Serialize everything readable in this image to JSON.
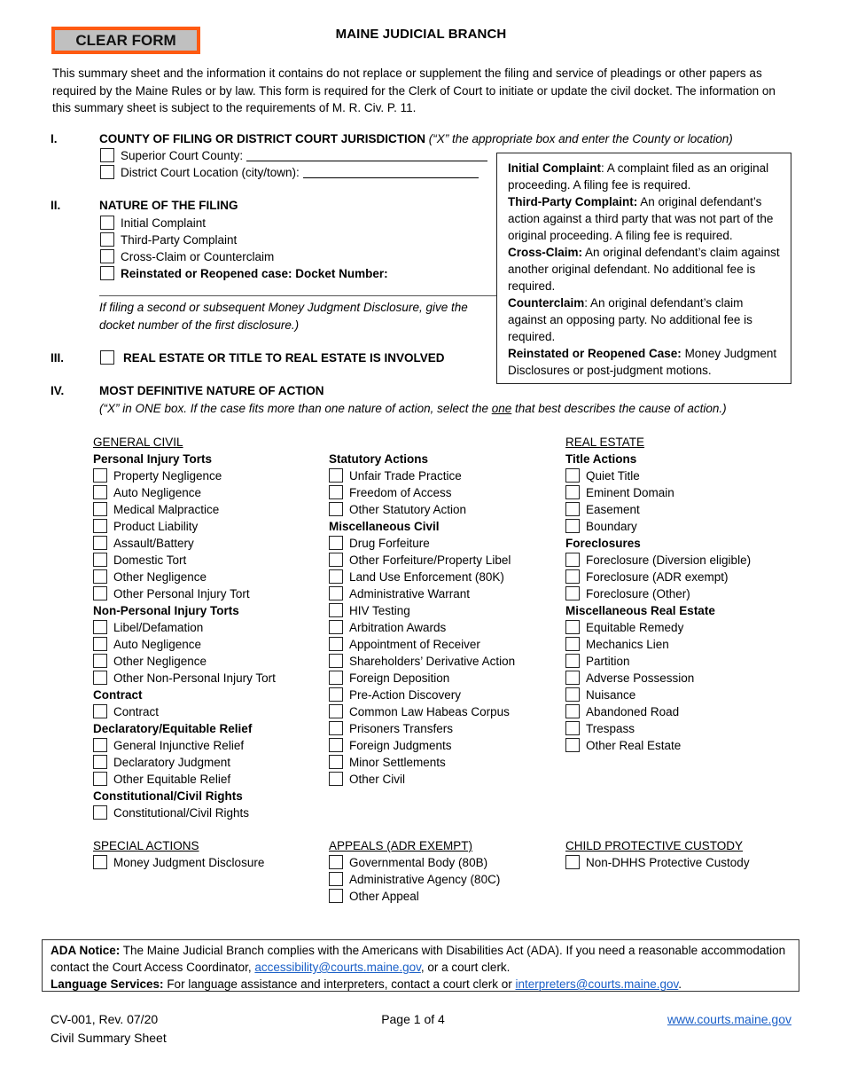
{
  "header": {
    "clear_button": "CLEAR FORM",
    "title": "MAINE JUDICIAL BRANCH",
    "intro": "This summary sheet and the information it contains do not replace or supplement the filing and service of pleadings or other papers as required by the Maine Rules or by law.  This form is required for the Clerk of Court to initiate or update the civil docket. The information on this summary sheet is subject to the requirements of M. R. Civ. P. 11."
  },
  "section1": {
    "num": "I.",
    "heading": "COUNTY OF FILING OR DISTRICT COURT JURISDICTION",
    "instruction": "(“X” the appropriate box and enter the County or location)",
    "superior_label": "Superior Court County:",
    "superior_value": "",
    "district_label": "District Court Location (city/town):",
    "district_value": ""
  },
  "section2": {
    "num": "II.",
    "heading": "NATURE OF THE FILING",
    "options": [
      "Initial Complaint",
      "Third-Party Complaint",
      "Cross-Claim or Counterclaim"
    ],
    "reopened_label": "Reinstated or Reopened case: Docket Number:",
    "docket_value": "",
    "note": "If filing a second or subsequent Money Judgment Disclosure, give the docket number of the first disclosure.)"
  },
  "info_box": [
    {
      "term": "Initial Complaint",
      "sep": ": ",
      "text": "A complaint filed as an original proceeding. A filing fee is required."
    },
    {
      "term": "Third-Party Complaint:",
      "sep": " ",
      "text": "An original defendant’s action against a third party that was not part of the original proceeding. A filing fee is required."
    },
    {
      "term": "Cross-Claim:",
      "sep": " ",
      "text": "An original defendant’s claim against another original defendant. No additional fee is required."
    },
    {
      "term": "Counterclaim",
      "sep": ": ",
      "text": "An original defendant’s claim against an opposing party. No additional fee is required."
    },
    {
      "term": "Reinstated or Reopened Case:",
      "sep": " ",
      "text": "Money Judgment Disclosures or post-judgment motions."
    }
  ],
  "section3": {
    "num": "III.",
    "label": "REAL ESTATE OR TITLE TO REAL ESTATE IS INVOLVED"
  },
  "section4": {
    "num": "IV.",
    "heading": "MOST DEFINITIVE NATURE OF ACTION",
    "instr_a": "(“X” in ONE box. If the case fits more than one nature of action, select the ",
    "instr_u": "one",
    "instr_b": " that best describes the cause of action.)"
  },
  "columns": {
    "general_civil": {
      "header": "GENERAL CIVIL",
      "groups": [
        {
          "name": "Personal Injury Torts",
          "items": [
            "Property Negligence",
            "Auto Negligence",
            "Medical Malpractice",
            "Product Liability",
            "Assault/Battery",
            "Domestic Tort",
            "Other Negligence",
            "Other Personal Injury Tort"
          ]
        },
        {
          "name": "Non-Personal Injury Torts",
          "items": [
            "Libel/Defamation",
            "Auto Negligence",
            "Other Negligence",
            "Other Non-Personal Injury Tort"
          ]
        },
        {
          "name": "Contract",
          "items": [
            "Contract"
          ]
        },
        {
          "name": "Declaratory/Equitable Relief",
          "items": [
            "General Injunctive Relief",
            "Declaratory Judgment",
            "Other Equitable Relief"
          ]
        },
        {
          "name": "Constitutional/Civil Rights",
          "items": [
            "Constitutional/Civil Rights"
          ]
        }
      ]
    },
    "statutory": {
      "groups": [
        {
          "name": "Statutory Actions",
          "items": [
            "Unfair Trade Practice",
            "Freedom of Access",
            "Other Statutory Action"
          ]
        },
        {
          "name": "Miscellaneous Civil",
          "items": [
            "Drug Forfeiture",
            "Other Forfeiture/Property Libel",
            "Land Use Enforcement (80K)",
            "Administrative Warrant",
            "HIV Testing",
            "Arbitration Awards",
            "Appointment of Receiver",
            "Shareholders’ Derivative Action",
            "Foreign Deposition",
            "Pre-Action Discovery",
            "Common Law Habeas Corpus",
            "Prisoners Transfers",
            "Foreign Judgments",
            "Minor Settlements",
            "Other Civil"
          ]
        }
      ]
    },
    "real_estate": {
      "header": "REAL ESTATE",
      "groups": [
        {
          "name": "Title Actions",
          "items": [
            "Quiet Title",
            "Eminent Domain",
            "Easement",
            "Boundary"
          ]
        },
        {
          "name": "Foreclosures",
          "items": [
            "Foreclosure (Diversion eligible)",
            "Foreclosure (ADR exempt)",
            "Foreclosure (Other)"
          ]
        },
        {
          "name": "Miscellaneous Real Estate",
          "items": [
            "Equitable Remedy",
            "Mechanics Lien",
            "Partition",
            "Adverse Possession",
            "Nuisance",
            "Abandoned Road",
            "Trespass",
            "Other Real Estate"
          ]
        }
      ]
    },
    "special_actions": {
      "header": "SPECIAL ACTIONS",
      "items": [
        "Money Judgment Disclosure"
      ]
    },
    "appeals": {
      "header": "APPEALS (ADR EXEMPT)",
      "items": [
        "Governmental Body (80B)",
        "Administrative Agency (80C)",
        "Other Appeal"
      ]
    },
    "child_custody": {
      "header": "CHILD PROTECTIVE CUSTODY",
      "items": [
        "Non-DHHS Protective Custody"
      ]
    }
  },
  "notice": {
    "ada_label": "ADA Notice:",
    "ada_text": " The Maine Judicial Branch complies with the Americans with Disabilities Act (ADA). If you need a reasonable accommodation contact the Court Access Coordinator, ",
    "ada_email": "accessibility@courts.maine.gov",
    "ada_tail": ", or a court clerk.",
    "lang_label": "Language Services:",
    "lang_text": " For language assistance and interpreters, contact a court clerk or ",
    "lang_email": "interpreters@courts.maine.gov",
    "lang_tail": "."
  },
  "footer": {
    "form_id": "CV-001, Rev. 07/20",
    "form_name": "Civil Summary Sheet",
    "page": "Page 1 of 4",
    "website": "www.courts.maine.gov"
  }
}
